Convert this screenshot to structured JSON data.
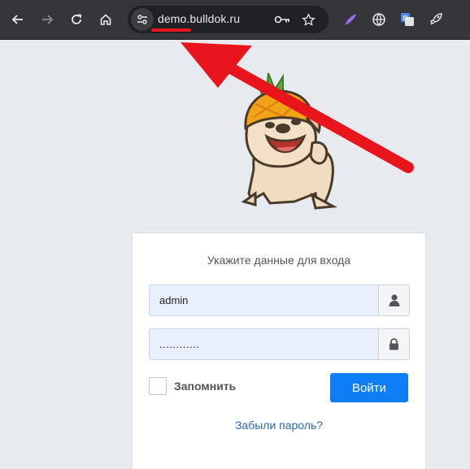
{
  "browser": {
    "url": "demo.bulldok.ru",
    "icons": {
      "back": "arrow-left-icon",
      "forward": "arrow-right-icon",
      "reload": "reload-icon",
      "home": "home-icon",
      "site_info": "tune-icon",
      "password": "key-icon",
      "bookmark": "star-icon",
      "extensions": [
        "feather-icon",
        "globe-icon",
        "translate-icon",
        "rocket-icon"
      ]
    }
  },
  "login": {
    "title": "Укажите данные для входа",
    "username": "admin",
    "password": "............",
    "remember_label": "Запомнить",
    "submit_label": "Войти",
    "forgot_link": "Забыли пароль?"
  },
  "colors": {
    "accent": "#0d7ef5",
    "link": "#2a69b3",
    "annotation": "#e8161c"
  }
}
